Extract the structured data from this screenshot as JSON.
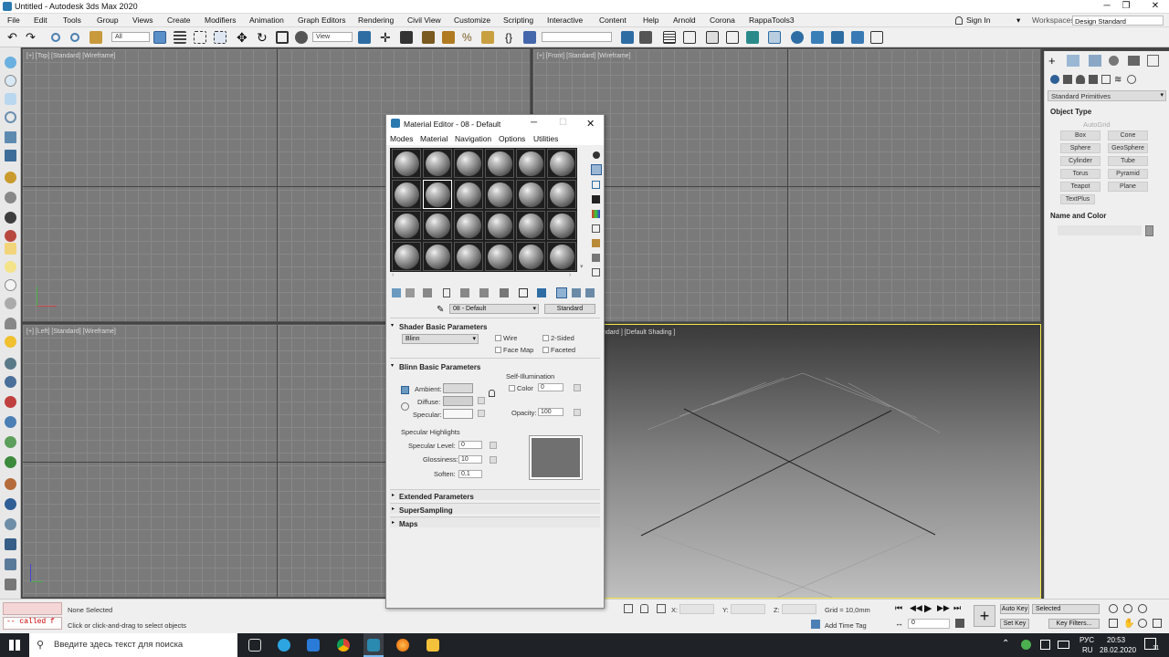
{
  "app": {
    "title": "Untitled - Autodesk 3ds Max 2020"
  },
  "menu": [
    "File",
    "Edit",
    "Tools",
    "Group",
    "Views",
    "Create",
    "Modifiers",
    "Animation",
    "Graph Editors",
    "Rendering",
    "Civil View",
    "Customize",
    "Scripting",
    "Interactive",
    "Content",
    "Help",
    "Arnold",
    "Corona",
    "RappaTools3"
  ],
  "signin": "Sign In",
  "workspace": {
    "label": "Workspaces:",
    "value": "Design Standard"
  },
  "toolbar": {
    "filter": "All",
    "refcoord": "View"
  },
  "viewports": {
    "top": "[+] [Top] [Standard] [Wireframe]",
    "front": "[+] [Front] [Standard] [Wireframe]",
    "left": "[+] [Left] [Standard] [Wireframe]",
    "persp": "ndard ] [Default Shading ]"
  },
  "command_panel": {
    "dropdown": "Standard Primitives",
    "object_type": "Object Type",
    "autogrid": "AutoGrid",
    "buttons": [
      "Box",
      "Cone",
      "Sphere",
      "GeoSphere",
      "Cylinder",
      "Tube",
      "Torus",
      "Pyramid",
      "Teapot",
      "Plane",
      "TextPlus"
    ],
    "name_color": "Name and Color"
  },
  "material_editor": {
    "title": "Material Editor - 08 - Default",
    "menu": [
      "Modes",
      "Material",
      "Navigation",
      "Options",
      "Utilities"
    ],
    "material_name": "08 - Default",
    "type_button": "Standard",
    "shader_rollout": "Shader Basic Parameters",
    "shader": "Blinn",
    "opts": {
      "wire": "Wire",
      "two_sided": "2-Sided",
      "face_map": "Face Map",
      "faceted": "Faceted"
    },
    "blinn_rollout": "Blinn Basic Parameters",
    "self_illum": "Self-Illumination",
    "color_label": "Color",
    "color_value": "0",
    "ambient": "Ambient:",
    "diffuse": "Diffuse:",
    "specular": "Specular:",
    "opacity_label": "Opacity:",
    "opacity": "100",
    "spec_highlights": "Specular Highlights",
    "spec_level_label": "Specular Level:",
    "spec_level": "0",
    "gloss_label": "Glossiness:",
    "gloss": "10",
    "soften_label": "Soften:",
    "soften": "0,1",
    "extended": "Extended Parameters",
    "supersampling": "SuperSampling",
    "maps": "Maps"
  },
  "status": {
    "maxscript": "-- called f",
    "selected": "None Selected",
    "hint": "Click or click-and-drag to select objects",
    "x_label": "X:",
    "y_label": "Y:",
    "z_label": "Z:",
    "grid": "Grid = 10,0mm",
    "add_time_tag": "Add Time Tag",
    "frame": "0",
    "auto_key": "Auto Key",
    "set_key": "Set Key",
    "key_mode": "Selected",
    "key_filters": "Key Filters..."
  },
  "taskbar": {
    "search": "Введите здесь текст для поиска",
    "lang": "РУС",
    "lang2": "RU",
    "time": "20:53",
    "date": "28.02.2020",
    "notif": "11"
  }
}
